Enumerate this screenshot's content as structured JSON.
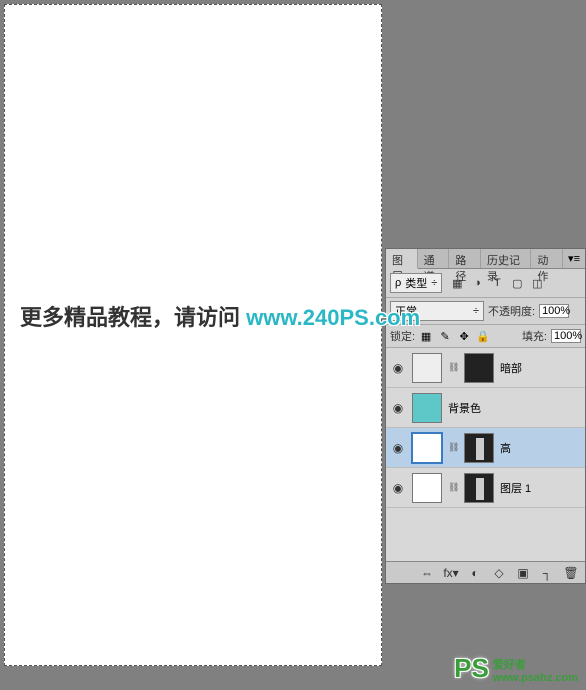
{
  "watermark": {
    "prefix": "更多精品教程，请访问",
    "url": "www.240PS.com"
  },
  "badge": {
    "logo": "PS",
    "line1": "爱好者",
    "line2": "www.psahz.com"
  },
  "panel": {
    "tabs": [
      "图层",
      "通道",
      "路径",
      "历史记录",
      "动作"
    ],
    "active_tab": 0,
    "menu_glyph": "▾≡",
    "filter": {
      "search_glyph": "ρ",
      "label": "类型",
      "chevron": "÷",
      "icons": [
        "▦",
        "◑",
        "T",
        "▢",
        "◫"
      ]
    },
    "blend": {
      "mode": "正常",
      "chevron": "÷",
      "opacity_label": "不透明度:",
      "opacity_value": "100%"
    },
    "lock": {
      "label": "锁定:",
      "icons": [
        "▦",
        "✎",
        "✥",
        "🔒"
      ],
      "fill_label": "填充:",
      "fill_value": "100%"
    },
    "layers": [
      {
        "name": "暗部",
        "has_mask": true,
        "thumb_style": "mask1",
        "selected": false
      },
      {
        "name": "背景色",
        "has_mask": false,
        "thumb_style": "teal",
        "selected": false
      },
      {
        "name": "高",
        "has_mask": true,
        "thumb_style": "bldg",
        "selected": true
      },
      {
        "name": "图层 1",
        "has_mask": true,
        "thumb_style": "bldg",
        "selected": false
      }
    ],
    "footer_icons": [
      "⇔",
      "fx▾",
      "◐",
      "◇",
      "▣",
      "┐",
      "🗑"
    ]
  }
}
